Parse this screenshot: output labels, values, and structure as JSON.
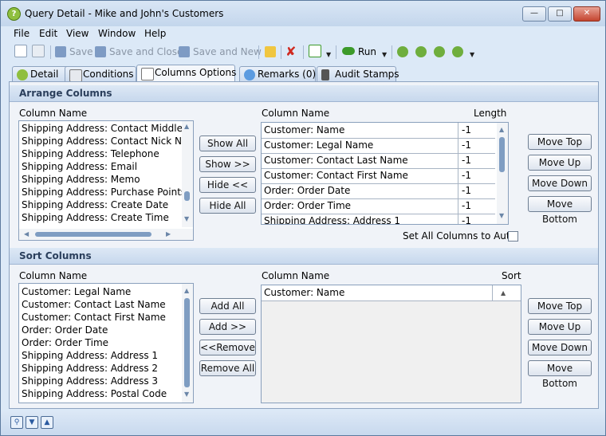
{
  "window": {
    "title": "Query Detail - Mike and John's Customers"
  },
  "menu": [
    "File",
    "Edit",
    "View",
    "Window",
    "Help"
  ],
  "toolbar": {
    "save": "Save",
    "save_and_close": "Save and Close",
    "save_and_new": "Save and New",
    "run": "Run"
  },
  "tabs": [
    "Detail",
    "Conditions",
    "Columns Options",
    "Remarks (0)",
    "Audit Stamps"
  ],
  "arrange": {
    "header": "Arrange Columns",
    "left_label": "Column Name",
    "available": [
      "Shipping Address: Contact Middle Na",
      "Shipping Address: Contact Nick Nam",
      "Shipping Address: Telephone",
      "Shipping Address: Email",
      "Shipping Address: Memo",
      "Shipping Address: Purchase Points",
      "Shipping Address: Create Date",
      "Shipping Address: Create Time"
    ],
    "buttons": [
      "Show All",
      "Show >>",
      "Hide <<",
      "Hide All"
    ],
    "right_label": "Column Name",
    "length_label": "Length",
    "selected": [
      {
        "name": "Customer: Name",
        "length": "-1"
      },
      {
        "name": "Customer: Legal Name",
        "length": "-1"
      },
      {
        "name": "Customer: Contact Last Name",
        "length": "-1"
      },
      {
        "name": "Customer: Contact First Name",
        "length": "-1"
      },
      {
        "name": "Order: Order Date",
        "length": "-1"
      },
      {
        "name": "Order: Order Time",
        "length": "-1"
      },
      {
        "name": "Shipping Address: Address 1",
        "length": "-1"
      }
    ],
    "move_buttons": [
      "Move Top",
      "Move Up",
      "Move Down",
      "Move Bottom"
    ],
    "set_all_auto": "Set All Columns to Auto"
  },
  "sort": {
    "header": "Sort Columns",
    "left_label": "Column Name",
    "available": [
      "Customer: Legal Name",
      "Customer: Contact Last Name",
      "Customer: Contact First Name",
      "Order: Order Date",
      "Order: Order Time",
      "Shipping Address: Address 1",
      "Shipping Address: Address 2",
      "Shipping Address: Address 3",
      "Shipping Address: Postal Code"
    ],
    "buttons": [
      "Add All",
      "Add >>",
      "<<Remove",
      "Remove All"
    ],
    "right_label": "Column Name",
    "sort_label": "Sort",
    "selected": [
      {
        "name": "Customer: Name"
      }
    ],
    "move_buttons": [
      "Move Top",
      "Move Up",
      "Move Down",
      "Move Bottom"
    ]
  },
  "icons": {
    "title": "query-icon",
    "new": "new-document-icon",
    "copy": "copy-icon",
    "save": "save-icon",
    "save_close": "save-close-icon",
    "save_new": "save-new-icon",
    "open": "folder-icon",
    "delete": "delete-icon",
    "refresh": "refresh-icon",
    "run": "run-icon",
    "users": "user-icon",
    "status": [
      "zoom-icon",
      "arrow-down-icon",
      "arrow-up-icon"
    ]
  },
  "colors": {
    "accent": "#4d7ab5",
    "delete": "#d02a20",
    "run": "#3c9a2a"
  }
}
